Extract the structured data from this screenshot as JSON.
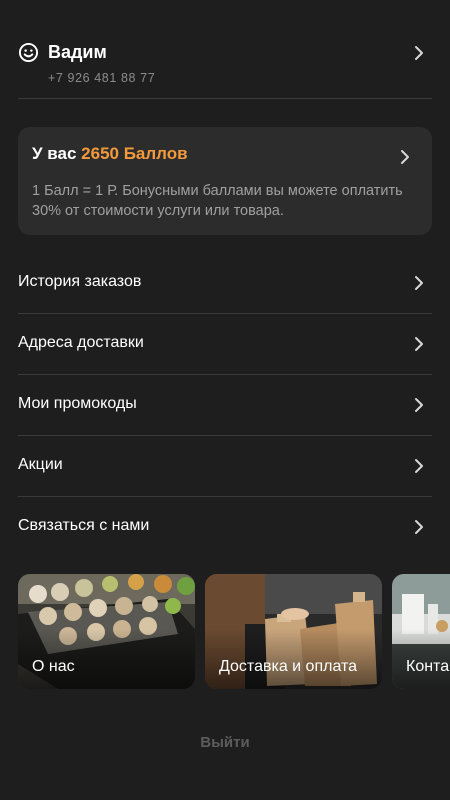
{
  "profile": {
    "name": "Вадим",
    "phone": "+7 926 481 88 77",
    "icon": "smile-icon"
  },
  "bonus": {
    "title_prefix": "У вас ",
    "points": "2650 Баллов",
    "description": "1 Балл = 1 Р. Бонусными баллами вы можете оплатить 30% от стоимости услуги или товара.",
    "accent_color": "#f39a3c"
  },
  "menu": {
    "items": [
      {
        "label": "История заказов"
      },
      {
        "label": "Адреса доставки"
      },
      {
        "label": "Мои промокоды"
      },
      {
        "label": "Акции"
      },
      {
        "label": "Связаться с нами"
      }
    ]
  },
  "cards": [
    {
      "caption": "О нас"
    },
    {
      "caption": "Доставка и оплата"
    },
    {
      "caption": "Контакты"
    }
  ],
  "logout_label": "Выйти"
}
